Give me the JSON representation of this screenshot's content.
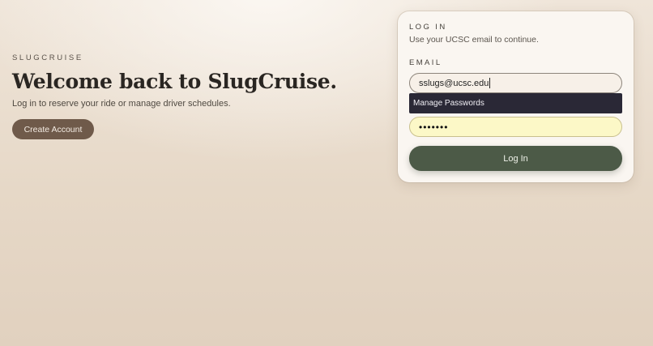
{
  "hero": {
    "eyebrow": "SLUGCRUISE",
    "headline": "Welcome back to SlugCruise.",
    "subtext": "Log in to reserve your ride or manage driver schedules.",
    "create_account_label": "Create Account"
  },
  "login": {
    "eyebrow": "LOG IN",
    "hint": "Use your UCSC email to continue.",
    "email_label": "EMAIL",
    "email_value": "sslugs@ucsc.edu",
    "autofill_item": "Manage Passwords",
    "password_value": "•••••••",
    "login_label": "Log In"
  },
  "colors": {
    "primary_button": "#4c5a47",
    "secondary_button": "#6f5a4a",
    "autofill_background": "#fcf8c7",
    "menu_background": "#2a2836"
  }
}
